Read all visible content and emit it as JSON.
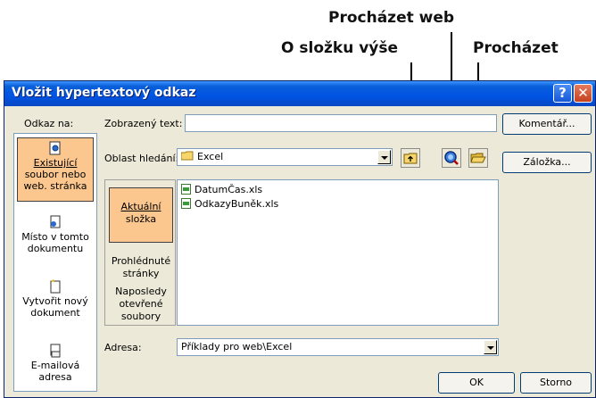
{
  "callouts": {
    "browse_web": "Procházet web",
    "up_folder": "O složku výše",
    "browse": "Procházet"
  },
  "dialog": {
    "title": "Vložit hypertextový odkaz",
    "link_to_label": "Odkaz na:",
    "display_text_label": "Zobrazený text:",
    "display_text_value": "",
    "look_in_label": "Oblast hledání:",
    "look_in_value": "Excel",
    "address_label": "Adresa:",
    "address_value": "Příklady pro web\\Excel",
    "buttons": {
      "screentip": "Komentář...",
      "bookmark": "Záložka...",
      "ok": "OK",
      "cancel": "Storno"
    },
    "link_types": [
      {
        "line1": "Existující",
        "line2": "soubor nebo",
        "line3": "web. stránka"
      },
      {
        "line1": "Místo v tomto",
        "line2": "dokumentu"
      },
      {
        "line1": "Vytvořit nový",
        "line2": "dokument"
      },
      {
        "line1": "E-mailová",
        "line2": "adresa"
      }
    ],
    "places": [
      {
        "line1": "Aktuální",
        "line2": "složka"
      },
      {
        "line1": "Prohlédnuté",
        "line2": "stránky"
      },
      {
        "line1": "Naposledy",
        "line2": "otevřené",
        "line3": "soubory"
      }
    ],
    "files": [
      "DatumČas.xls",
      "OdkazyBuněk.xls"
    ]
  },
  "colors": {
    "titlebar": "#0054e3",
    "selected_bg": "#fbc78e",
    "dialog_bg": "#ece9d8"
  }
}
